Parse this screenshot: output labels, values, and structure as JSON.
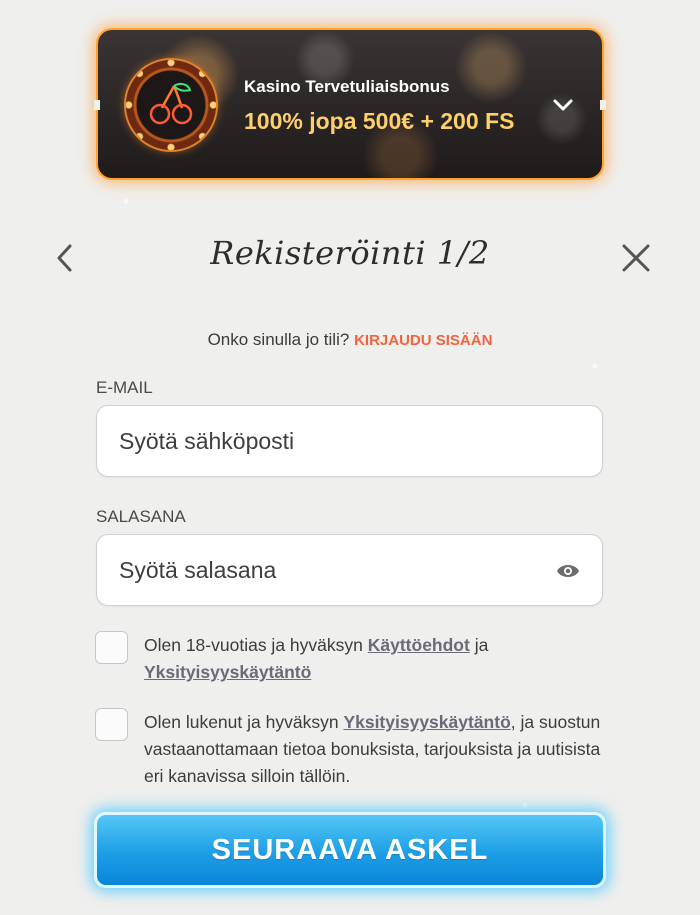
{
  "promo": {
    "title": "Kasino Tervetuliaisbonus",
    "offer": "100% jopa 500€ + 200 FS",
    "icon": "chevron-down-icon",
    "accent_color": "#ffa22b",
    "offer_color": "#ffcf6a"
  },
  "header": {
    "title": "Rekisteröinti 1/2",
    "back_icon": "chevron-left-icon",
    "close_icon": "close-icon"
  },
  "login": {
    "prompt": "Onko sinulla jo tili?",
    "link": "KIRJAUDU SISÄÄN",
    "link_color": "#f0643f"
  },
  "fields": {
    "email": {
      "label": "E-MAIL",
      "placeholder": "Syötä sähköposti",
      "value": ""
    },
    "password": {
      "label": "SALASANA",
      "placeholder": "Syötä salasana",
      "value": "",
      "icon": "eye-icon"
    }
  },
  "consents": [
    {
      "checked": false,
      "text_before": "Olen 18-vuotias ja hyväksyn",
      "link1": "Käyttöehdot",
      "text_middle": "ja",
      "link2": "Yksityisyyskäytäntö"
    },
    {
      "checked": false,
      "text_before": "Olen lukenut ja hyväksyn",
      "link1": "Yksityisyyskäytäntö",
      "text_after": ", ja suostun vastaanottamaan tietoa bonuksista, tarjouksista ja uutisista eri kanavissa silloin tällöin."
    }
  ],
  "submit": {
    "label": "SEURAAVA ASKEL",
    "color": "#1d9ee6"
  }
}
